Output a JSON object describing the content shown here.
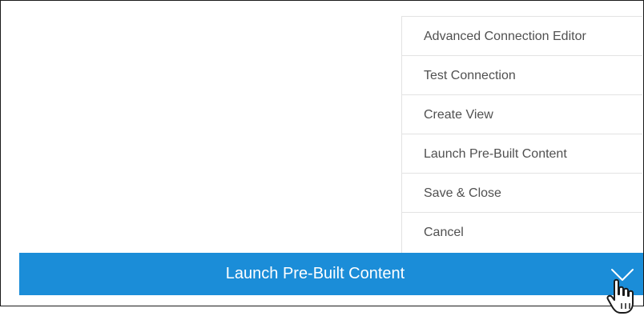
{
  "menu": {
    "items": [
      {
        "label": "Advanced Connection Editor"
      },
      {
        "label": "Test Connection"
      },
      {
        "label": "Create View"
      },
      {
        "label": "Launch Pre-Built Content"
      },
      {
        "label": "Save & Close"
      },
      {
        "label": "Cancel"
      }
    ]
  },
  "action_bar": {
    "label": "Launch Pre-Built Content",
    "toggle_icon": "chevron-down-icon",
    "color": "#1b8dd8"
  },
  "cursor": {
    "icon": "hand-pointer-icon"
  }
}
